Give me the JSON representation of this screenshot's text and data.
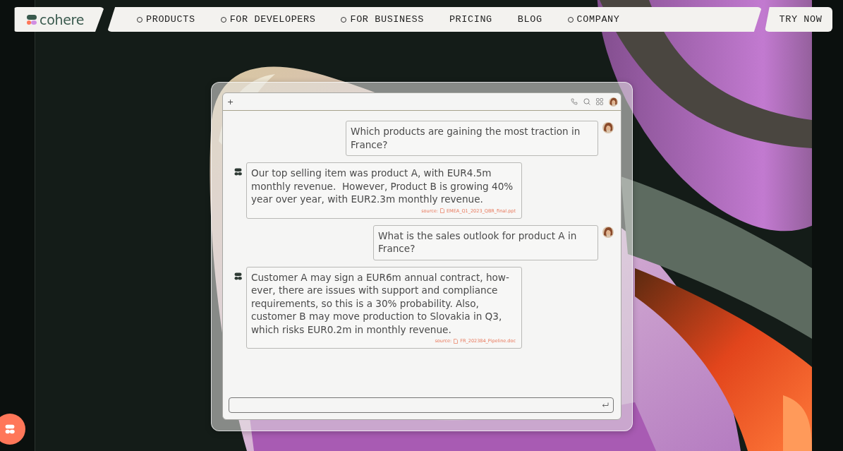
{
  "nav": {
    "logo": "cohere",
    "items": [
      {
        "label": "PRODUCTS",
        "has_menu": true
      },
      {
        "label": "FOR DEVELOPERS",
        "has_menu": true
      },
      {
        "label": "FOR BUSINESS",
        "has_menu": true
      },
      {
        "label": "PRICING",
        "has_menu": false
      },
      {
        "label": "BLOG",
        "has_menu": false
      },
      {
        "label": "COMPANY",
        "has_menu": true
      }
    ],
    "cta": "TRY NOW"
  },
  "chat": {
    "new_tab": "+",
    "messages": [
      {
        "kind": "user",
        "text": "Which products are gaining the most traction in France?"
      },
      {
        "kind": "bot",
        "text": "Our top selling item was product A, with EUR4.5m monthly revenue.  However, Product B is growing 40% year over year, with EUR2.3m monthly revenue.",
        "source_label": "source:",
        "source_file": "EMEA_Q1_2023_QBR_final.ppt"
      },
      {
        "kind": "user",
        "text": "What is the sales outlook for product A in France?"
      },
      {
        "kind": "bot",
        "text": "Customer A may sign a EUR6m annual contract, how-ever, there are issues with support and compliance requirements, so this is a 30% probability. Also, customer B may move production to Slovakia in Q3, which risks EUR0.2m in monthly revenue.",
        "source_label": "source:",
        "source_file": "FR_202384_Pipeline.doc"
      }
    ]
  }
}
